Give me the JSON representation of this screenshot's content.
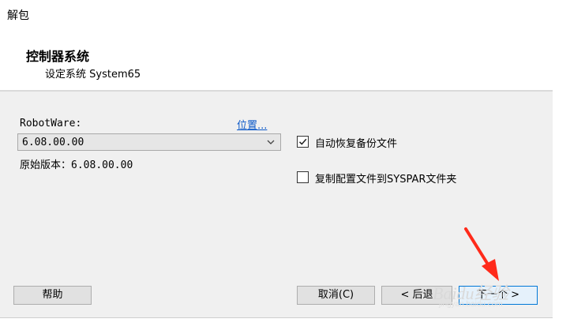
{
  "window": {
    "title": "解包"
  },
  "header": {
    "title": "控制器系统",
    "subtitle": "设定系统 System65"
  },
  "robotware": {
    "label": "RobotWare:",
    "location_link": "位置...",
    "selected_version": "6.08.00.00",
    "original_label": "原始版本：",
    "original_version": "6.08.00.00"
  },
  "options": [
    {
      "label": "自动恢复备份文件",
      "checked": true
    },
    {
      "label": "复制配置文件到SYSPAR文件夹",
      "checked": false
    }
  ],
  "buttons": {
    "help": "帮助",
    "cancel": "取消(C)",
    "back": "< 后退",
    "next": "下一个 >"
  },
  "watermark": {
    "text": "Baidu经验",
    "sub": "jingyan.baidu.com"
  },
  "colors": {
    "link": "#0b58c8",
    "arrow": "#ff2a1a",
    "focus": "#0078d7"
  }
}
